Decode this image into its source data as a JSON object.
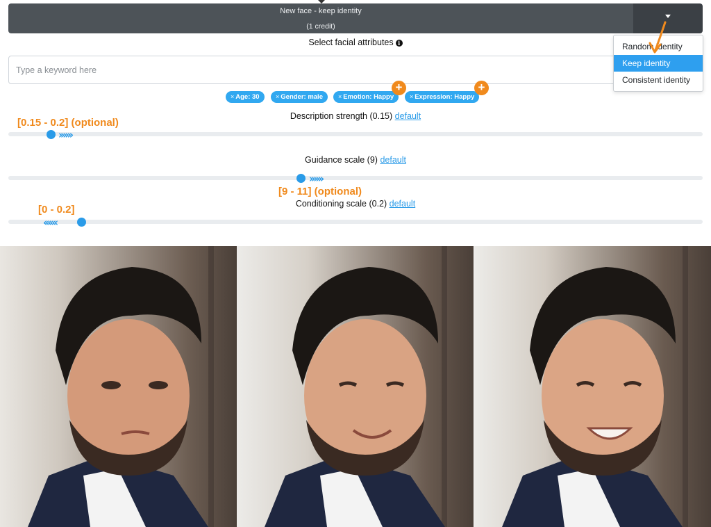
{
  "generate": {
    "title": "New face - keep identity",
    "subtitle": "(1 credit)"
  },
  "identity_menu": {
    "items": [
      "Random identity",
      "Keep identity",
      "Consistent identity"
    ],
    "selected": "Keep identity",
    "accent": "#2e9fef"
  },
  "attributes": {
    "heading": "Select facial attributes",
    "info_glyph": "i",
    "search_placeholder": "Type a keyword here",
    "tags": [
      {
        "x": "×",
        "label": "Age: 30"
      },
      {
        "x": "×",
        "label": "Gender: male"
      },
      {
        "x": "×",
        "label": "Emotion: Happy"
      },
      {
        "x": "×",
        "label": "Expression: Happy"
      }
    ],
    "plus_glyph": "+"
  },
  "sliders": [
    {
      "label": "Description strength (0.15)",
      "default_link": "default",
      "annotation": "[0.15 - 0.2] (optional)",
      "chevrons": "››››››",
      "value": 0.15
    },
    {
      "label": "Guidance scale (9)",
      "default_link": "default",
      "annotation": "[9 - 11] (optional)",
      "chevrons": "››››››",
      "value": 9
    },
    {
      "label": "Conditioning scale (0.2)",
      "default_link": "default",
      "annotation": "[0 - 0.2]",
      "chevrons": "‹‹‹‹‹‹",
      "value": 0.2
    }
  ],
  "colors": {
    "button_dark": "#4d5358",
    "accent_blue": "#2a9be8",
    "annotation_orange": "#f08a1d",
    "tag_blue": "#31a8f0"
  },
  "photos": [
    "portrait-neutral",
    "portrait-smile",
    "portrait-big-smile"
  ]
}
